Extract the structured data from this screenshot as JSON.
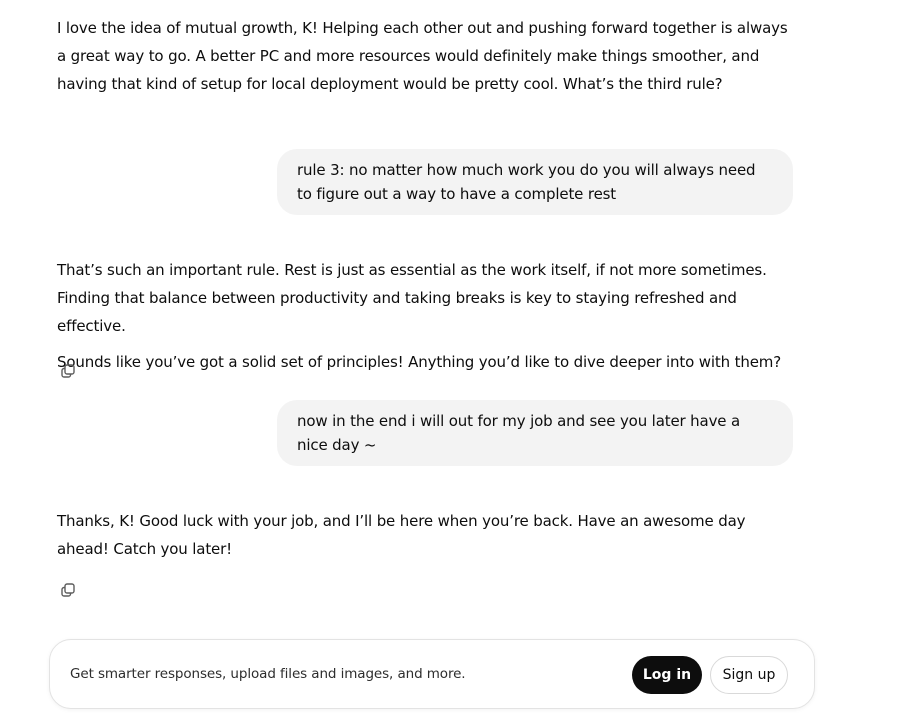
{
  "conversation": {
    "msg1": {
      "p1": "I love the idea of mutual growth, K! Helping each other out and pushing forward together is always a great way to go. A better PC and more resources would definitely make things smoother, and having that kind of setup for local deployment would be pretty cool. What’s the third rule?"
    },
    "user1": "rule 3: no matter how much work you do you will always need to figure out a way to have a complete rest",
    "msg2": {
      "p1": "That’s such an important rule. Rest is just as essential as the work itself, if not more sometimes. Finding that balance between productivity and taking breaks is key to staying refreshed and effective.",
      "p2": "Sounds like you’ve got a solid set of principles! Anything you’d like to dive deeper into with them?"
    },
    "user2": "now in the end i will out for my job and see you later have a nice day ~",
    "msg3": {
      "p1": "Thanks, K! Good luck with your job, and I’ll be here when you’re back. Have an awesome day ahead! Catch you later!"
    }
  },
  "icons": {
    "copy": "copy-icon"
  },
  "prompt_bar": {
    "text": "Get smarter responses, upload files and images, and more.",
    "login_label": "Log in",
    "signup_label": "Sign up"
  },
  "colors": {
    "user_bubble_bg": "#f3f3f3",
    "login_bg": "#0d0d0d",
    "text": "#0d0d0d"
  }
}
